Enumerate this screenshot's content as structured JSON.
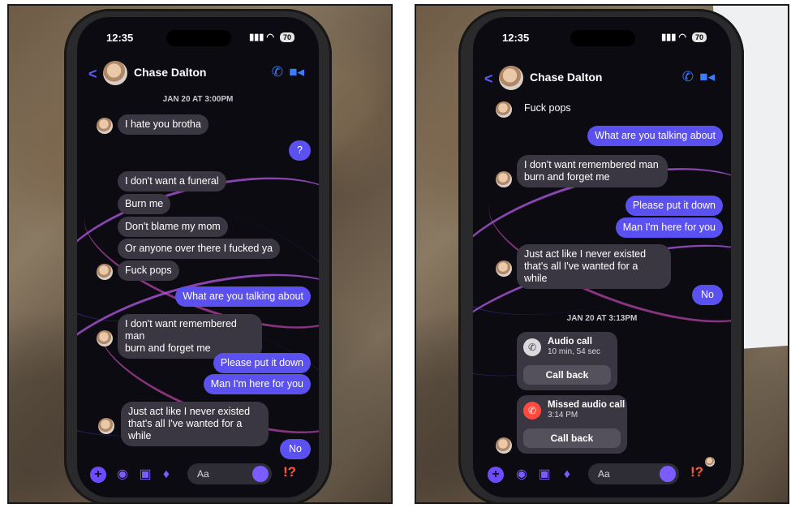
{
  "status_bar": {
    "time": "12:35",
    "battery_left": "70",
    "battery_right": "70"
  },
  "chat": {
    "contact_name": "Chase Dalton",
    "back_glyph": "<",
    "composer_placeholder": "Aa",
    "react_glyph": "!?"
  },
  "left_screen": {
    "timestamp": "JAN 20 AT 3:00PM",
    "messages": [
      {
        "dir": "in",
        "text": "I hate you brotha"
      },
      {
        "dir": "out",
        "text": "?"
      },
      {
        "dir": "in",
        "text": "I don't want a funeral"
      },
      {
        "dir": "in",
        "text": "Burn me"
      },
      {
        "dir": "in",
        "text": "Don't blame my mom"
      },
      {
        "dir": "in",
        "text": "Or anyone over there I fucked ya"
      },
      {
        "dir": "in",
        "text": "Fuck pops"
      },
      {
        "dir": "out",
        "text": "What are you talking about"
      },
      {
        "dir": "in",
        "text": "I don't want remembered man"
      },
      {
        "dir": "in",
        "text": "burn and forget me"
      },
      {
        "dir": "out",
        "text": "Please put it down"
      },
      {
        "dir": "out",
        "text": "Man I'm here for you"
      },
      {
        "dir": "in",
        "text": "Just act like I never existed"
      },
      {
        "dir": "in",
        "text": "that's all I've wanted for a while"
      },
      {
        "dir": "out",
        "text": "No"
      }
    ]
  },
  "right_screen": {
    "messages": [
      {
        "dir": "in",
        "text": "Fuck pops"
      },
      {
        "dir": "out",
        "text": "What are you talking about"
      },
      {
        "dir": "in",
        "text": "I don't want remembered man"
      },
      {
        "dir": "in",
        "text": "burn and forget me"
      },
      {
        "dir": "out",
        "text": "Please put it down"
      },
      {
        "dir": "out",
        "text": "Man I'm here for you"
      },
      {
        "dir": "in",
        "text": "Just act like I never existed"
      },
      {
        "dir": "in",
        "text": "that's all I've wanted for a while"
      },
      {
        "dir": "out",
        "text": "No"
      }
    ],
    "timestamp": "JAN 20 AT 3:13PM",
    "calls": [
      {
        "title": "Audio call",
        "detail": "10 min, 54 sec",
        "button": "Call back",
        "icon": "phone-icon",
        "icon_color": "#d9d9de"
      },
      {
        "title": "Missed audio call",
        "detail": "3:14 PM",
        "button": "Call back",
        "icon": "missed-call-icon",
        "icon_color": "#ff4a3d"
      }
    ]
  },
  "colors": {
    "outgoing_bubble": "#5b50f0",
    "incoming_bubble": "#3b3742",
    "accent": "#3d7bff",
    "screen_bg": "#0c0b12"
  }
}
